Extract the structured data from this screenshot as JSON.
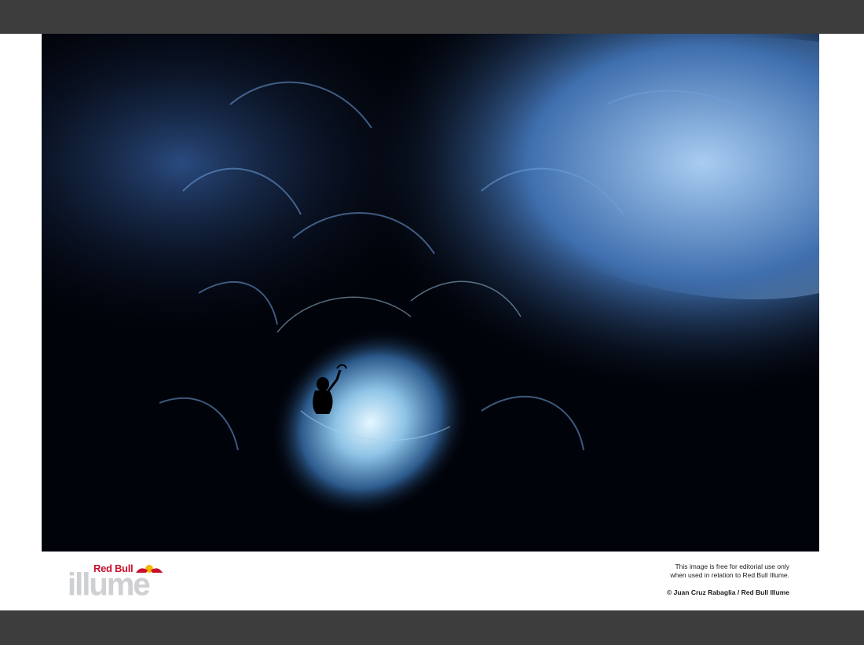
{
  "logo": {
    "brand": "Red Bull",
    "name": "illume"
  },
  "notice": {
    "line1": "This image is free for editorial use only",
    "line2": "when used in relation to Red Bull Illume."
  },
  "credit": "© Juan Cruz Rabaglia / Red Bull Illume",
  "photo": {
    "subject": "climber silhouette inside blue ice cave",
    "colors": {
      "dark": "#01030a",
      "ice": "#4a7fc4",
      "glow": "#cfeeff"
    }
  }
}
